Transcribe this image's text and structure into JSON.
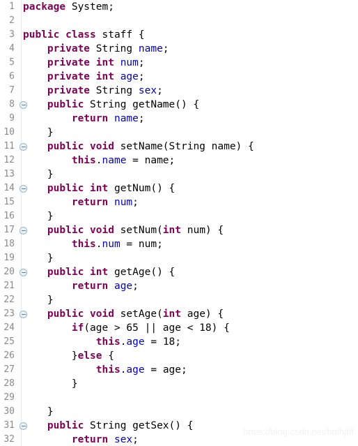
{
  "editor": {
    "language": "java",
    "theme": "eclipse-light",
    "background_color": "#ffffff",
    "gutter_color": "#ffffff",
    "line_number_color": "#898989",
    "keyword_color": "#7f0055",
    "field_color": "#0000c0",
    "plain_color": "#000000",
    "fold_marker_icon": "collapse-minus-circle-icon",
    "total_lines": 32
  },
  "watermark": {
    "text": "https://blog.csdn.net/hqfhjtff"
  },
  "lines": [
    {
      "number": "1",
      "fold": true,
      "tokens": [
        {
          "t": "package",
          "c": "kw"
        },
        {
          "t": " System;",
          "c": "pln"
        }
      ]
    },
    {
      "number": "2",
      "fold": false,
      "tokens": []
    },
    {
      "number": "3",
      "fold": false,
      "tokens": [
        {
          "t": "public class",
          "c": "kw"
        },
        {
          "t": " staff {",
          "c": "pln"
        }
      ]
    },
    {
      "number": "4",
      "fold": false,
      "tokens": [
        {
          "t": "    ",
          "c": "pln"
        },
        {
          "t": "private",
          "c": "kw"
        },
        {
          "t": " String ",
          "c": "pln"
        },
        {
          "t": "name",
          "c": "fld"
        },
        {
          "t": ";",
          "c": "pln"
        }
      ]
    },
    {
      "number": "5",
      "fold": false,
      "tokens": [
        {
          "t": "    ",
          "c": "pln"
        },
        {
          "t": "private int",
          "c": "kw"
        },
        {
          "t": " ",
          "c": "pln"
        },
        {
          "t": "num",
          "c": "fld"
        },
        {
          "t": ";",
          "c": "pln"
        }
      ]
    },
    {
      "number": "6",
      "fold": false,
      "tokens": [
        {
          "t": "    ",
          "c": "pln"
        },
        {
          "t": "private int",
          "c": "kw"
        },
        {
          "t": " ",
          "c": "pln"
        },
        {
          "t": "age",
          "c": "fld"
        },
        {
          "t": ";",
          "c": "pln"
        }
      ]
    },
    {
      "number": "7",
      "fold": false,
      "tokens": [
        {
          "t": "    ",
          "c": "pln"
        },
        {
          "t": "private",
          "c": "kw"
        },
        {
          "t": " String ",
          "c": "pln"
        },
        {
          "t": "sex",
          "c": "fld"
        },
        {
          "t": ";",
          "c": "pln"
        }
      ]
    },
    {
      "number": "8",
      "fold": true,
      "tokens": [
        {
          "t": "    ",
          "c": "pln"
        },
        {
          "t": "public",
          "c": "kw"
        },
        {
          "t": " String getName() {",
          "c": "pln"
        }
      ]
    },
    {
      "number": "9",
      "fold": false,
      "tokens": [
        {
          "t": "        ",
          "c": "pln"
        },
        {
          "t": "return",
          "c": "kw"
        },
        {
          "t": " ",
          "c": "pln"
        },
        {
          "t": "name",
          "c": "fld"
        },
        {
          "t": ";",
          "c": "pln"
        }
      ]
    },
    {
      "number": "10",
      "fold": false,
      "tokens": [
        {
          "t": "    }",
          "c": "pln"
        }
      ]
    },
    {
      "number": "11",
      "fold": true,
      "tokens": [
        {
          "t": "    ",
          "c": "pln"
        },
        {
          "t": "public void",
          "c": "kw"
        },
        {
          "t": " setName(String name) {",
          "c": "pln"
        }
      ]
    },
    {
      "number": "12",
      "fold": false,
      "tokens": [
        {
          "t": "        ",
          "c": "pln"
        },
        {
          "t": "this",
          "c": "kw"
        },
        {
          "t": ".",
          "c": "pln"
        },
        {
          "t": "name",
          "c": "fld"
        },
        {
          "t": " = name;",
          "c": "pln"
        }
      ]
    },
    {
      "number": "13",
      "fold": false,
      "tokens": [
        {
          "t": "    }",
          "c": "pln"
        }
      ]
    },
    {
      "number": "14",
      "fold": true,
      "tokens": [
        {
          "t": "    ",
          "c": "pln"
        },
        {
          "t": "public int",
          "c": "kw"
        },
        {
          "t": " getNum() {",
          "c": "pln"
        }
      ]
    },
    {
      "number": "15",
      "fold": false,
      "tokens": [
        {
          "t": "        ",
          "c": "pln"
        },
        {
          "t": "return",
          "c": "kw"
        },
        {
          "t": " ",
          "c": "pln"
        },
        {
          "t": "num",
          "c": "fld"
        },
        {
          "t": ";",
          "c": "pln"
        }
      ]
    },
    {
      "number": "16",
      "fold": false,
      "tokens": [
        {
          "t": "    }",
          "c": "pln"
        }
      ]
    },
    {
      "number": "17",
      "fold": true,
      "tokens": [
        {
          "t": "    ",
          "c": "pln"
        },
        {
          "t": "public void",
          "c": "kw"
        },
        {
          "t": " setNum(",
          "c": "pln"
        },
        {
          "t": "int",
          "c": "kw"
        },
        {
          "t": " num) {",
          "c": "pln"
        }
      ]
    },
    {
      "number": "18",
      "fold": false,
      "tokens": [
        {
          "t": "        ",
          "c": "pln"
        },
        {
          "t": "this",
          "c": "kw"
        },
        {
          "t": ".",
          "c": "pln"
        },
        {
          "t": "num",
          "c": "fld"
        },
        {
          "t": " = num;",
          "c": "pln"
        }
      ]
    },
    {
      "number": "19",
      "fold": false,
      "tokens": [
        {
          "t": "    }",
          "c": "pln"
        }
      ]
    },
    {
      "number": "20",
      "fold": true,
      "tokens": [
        {
          "t": "    ",
          "c": "pln"
        },
        {
          "t": "public int",
          "c": "kw"
        },
        {
          "t": " getAge() {",
          "c": "pln"
        }
      ]
    },
    {
      "number": "21",
      "fold": false,
      "tokens": [
        {
          "t": "        ",
          "c": "pln"
        },
        {
          "t": "return",
          "c": "kw"
        },
        {
          "t": " ",
          "c": "pln"
        },
        {
          "t": "age",
          "c": "fld"
        },
        {
          "t": ";",
          "c": "pln"
        }
      ]
    },
    {
      "number": "22",
      "fold": false,
      "tokens": [
        {
          "t": "    }",
          "c": "pln"
        }
      ]
    },
    {
      "number": "23",
      "fold": true,
      "tokens": [
        {
          "t": "    ",
          "c": "pln"
        },
        {
          "t": "public void",
          "c": "kw"
        },
        {
          "t": " setAge(",
          "c": "pln"
        },
        {
          "t": "int",
          "c": "kw"
        },
        {
          "t": " age) {",
          "c": "pln"
        }
      ]
    },
    {
      "number": "24",
      "fold": false,
      "tokens": [
        {
          "t": "        ",
          "c": "pln"
        },
        {
          "t": "if",
          "c": "kw"
        },
        {
          "t": "(age > 65 || age < 18) {",
          "c": "pln"
        }
      ]
    },
    {
      "number": "25",
      "fold": false,
      "tokens": [
        {
          "t": "            ",
          "c": "pln"
        },
        {
          "t": "this",
          "c": "kw"
        },
        {
          "t": ".",
          "c": "pln"
        },
        {
          "t": "age",
          "c": "fld"
        },
        {
          "t": " = 18;",
          "c": "pln"
        }
      ]
    },
    {
      "number": "26",
      "fold": false,
      "tokens": [
        {
          "t": "        }",
          "c": "pln"
        },
        {
          "t": "else",
          "c": "kw"
        },
        {
          "t": " {",
          "c": "pln"
        }
      ]
    },
    {
      "number": "27",
      "fold": false,
      "tokens": [
        {
          "t": "            ",
          "c": "pln"
        },
        {
          "t": "this",
          "c": "kw"
        },
        {
          "t": ".",
          "c": "pln"
        },
        {
          "t": "age",
          "c": "fld"
        },
        {
          "t": " = age;",
          "c": "pln"
        }
      ]
    },
    {
      "number": "28",
      "fold": false,
      "tokens": [
        {
          "t": "        }",
          "c": "pln"
        }
      ]
    },
    {
      "number": "29",
      "fold": false,
      "tokens": []
    },
    {
      "number": "30",
      "fold": false,
      "tokens": [
        {
          "t": "    }",
          "c": "pln"
        }
      ]
    },
    {
      "number": "31",
      "fold": true,
      "tokens": [
        {
          "t": "    ",
          "c": "pln"
        },
        {
          "t": "public",
          "c": "kw"
        },
        {
          "t": " String getSex() {",
          "c": "pln"
        }
      ]
    },
    {
      "number": "32",
      "fold": false,
      "tokens": [
        {
          "t": "        ",
          "c": "pln"
        },
        {
          "t": "return",
          "c": "kw"
        },
        {
          "t": " ",
          "c": "pln"
        },
        {
          "t": "sex",
          "c": "fld"
        },
        {
          "t": ";",
          "c": "pln"
        }
      ]
    }
  ]
}
